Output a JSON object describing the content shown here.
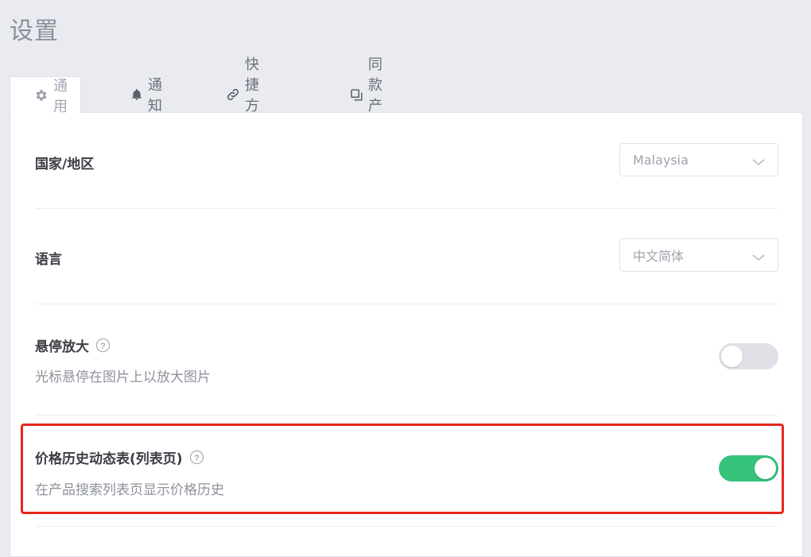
{
  "page": {
    "title": "设置"
  },
  "tabs": [
    {
      "label": "通用",
      "icon": "gear-icon",
      "active": true
    },
    {
      "label": "通知",
      "icon": "bell-icon"
    },
    {
      "label": "快捷方式",
      "icon": "link-icon"
    },
    {
      "label": "同款产品",
      "icon": "copy-icon"
    }
  ],
  "settings": {
    "country": {
      "label": "国家/地区",
      "value": "Malaysia"
    },
    "language": {
      "label": "语言",
      "value": "中文简体"
    },
    "hover_zoom": {
      "label": "悬停放大",
      "description": "光标悬停在图片上以放大图片",
      "enabled": false
    },
    "price_history": {
      "label": "价格历史动态表(列表页)",
      "description": "在产品搜索列表页显示价格历史",
      "enabled": true
    }
  },
  "colors": {
    "accent_green": "#35c27b",
    "highlight_red": "#e8261f",
    "background": "#e9ebf0"
  }
}
